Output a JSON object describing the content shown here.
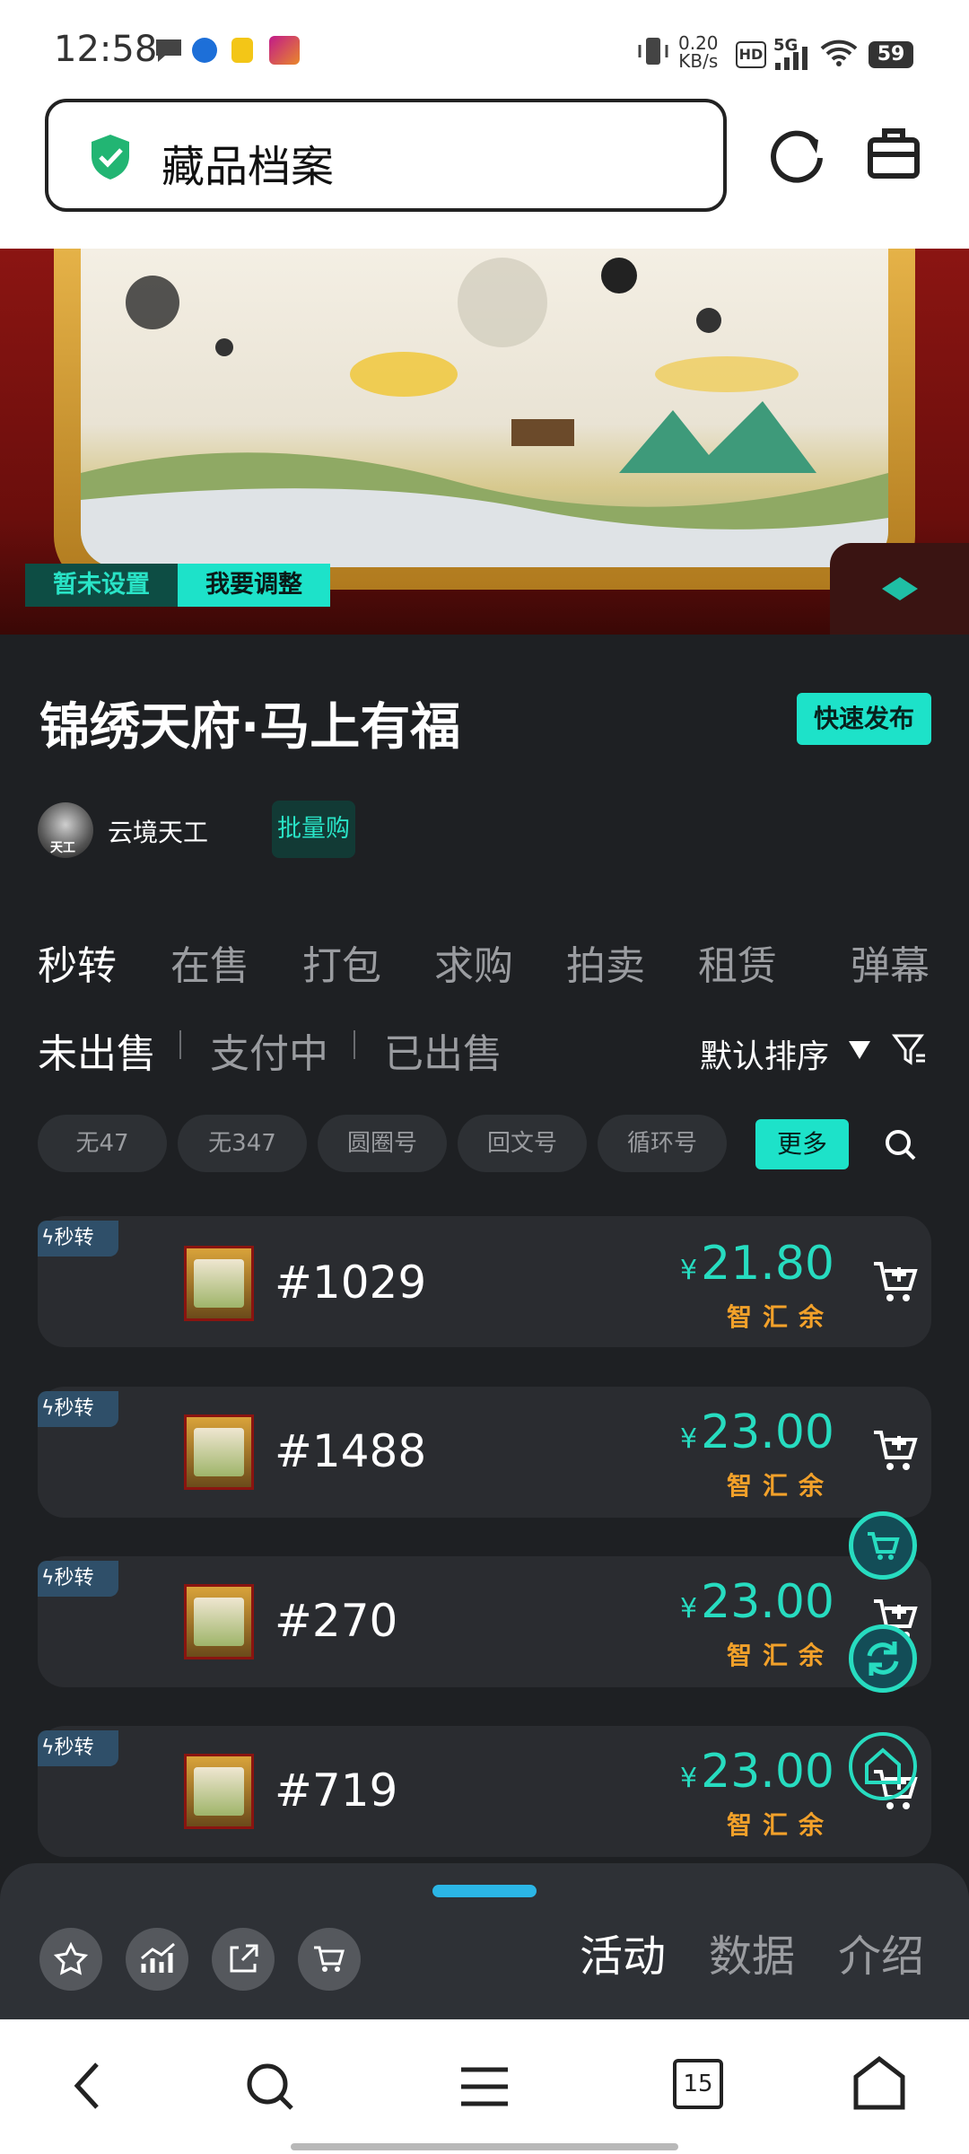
{
  "status_bar": {
    "time": "12:58",
    "net_speed_value": "0.20",
    "net_speed_unit": "KB/s",
    "hd_label": "HD",
    "network_label": "5G",
    "battery": "59"
  },
  "search": {
    "title": "藏品档案"
  },
  "hero": {
    "chip_unset": "暂未设置",
    "chip_adjust": "我要调整"
  },
  "product": {
    "title": "锦绣天府·马上有福",
    "quick_publish": "快速发布",
    "creator_name": "云境天工",
    "avatar_label": "天工",
    "bulk_buy": "批量购"
  },
  "tabs": [
    "秒转",
    "在售",
    "打包",
    "求购",
    "拍卖",
    "租赁",
    "弹幕"
  ],
  "sub_tabs": [
    "未出售",
    "支付中",
    "已出售"
  ],
  "sort_label": "默认排序",
  "tags": [
    "无47",
    "无347",
    "圆圈号",
    "回文号",
    "循环号"
  ],
  "tag_more": "更多",
  "items": [
    {
      "badge": "秒转",
      "name": "#1029",
      "price": "21.80",
      "currency": "¥",
      "pay": "智汇余"
    },
    {
      "badge": "秒转",
      "name": "#1488",
      "price": "23.00",
      "currency": "¥",
      "pay": "智汇余"
    },
    {
      "badge": "秒转",
      "name": "#270",
      "price": "23.00",
      "currency": "¥",
      "pay": "智汇余"
    },
    {
      "badge": "秒转",
      "name": "#719",
      "price": "23.00",
      "currency": "¥",
      "pay": "智汇余"
    }
  ],
  "sheet_tabs": [
    "活动",
    "数据",
    "介绍"
  ],
  "nav": {
    "tabs_count": "15"
  },
  "colors": {
    "accent": "#1de2c9",
    "price": "#27dcc0",
    "pay": "#f2a12a",
    "background": "#1e2023"
  }
}
